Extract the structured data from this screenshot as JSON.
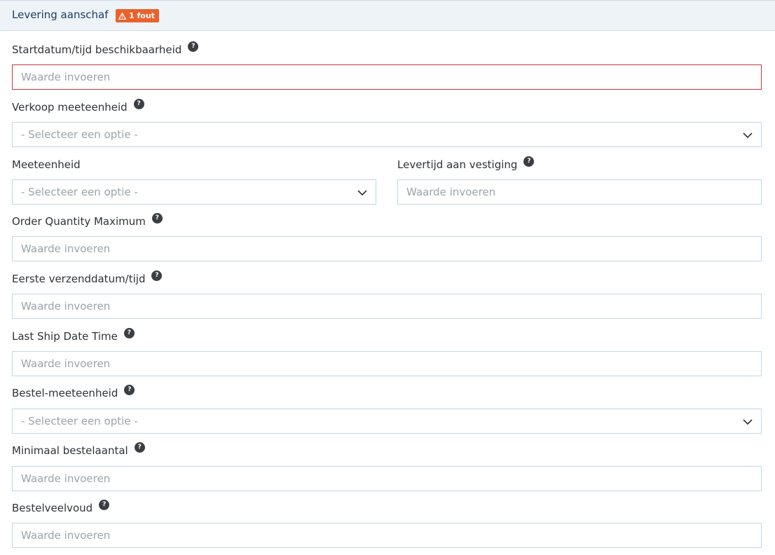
{
  "section": {
    "title": "Levering aanschaf",
    "error_badge": "1 fout"
  },
  "fields": {
    "startdatum": {
      "label": "Startdatum/tijd beschikbaarheid",
      "placeholder": "Waarde invoeren"
    },
    "verkoop_meeteenheid": {
      "label": "Verkoop meeteenheid",
      "placeholder": "- Selecteer een optie -"
    },
    "meeteenheid": {
      "label": "Meeteenheid",
      "placeholder": "- Selecteer een optie -"
    },
    "levertijd": {
      "label": "Levertijd aan vestiging",
      "placeholder": "Waarde invoeren"
    },
    "order_quantity_maximum": {
      "label": "Order Quantity Maximum",
      "placeholder": "Waarde invoeren"
    },
    "eerste_verzenddatum": {
      "label": "Eerste verzenddatum/tijd",
      "placeholder": "Waarde invoeren"
    },
    "last_ship_date_time": {
      "label": "Last Ship Date Time",
      "placeholder": "Waarde invoeren"
    },
    "bestel_meeteenheid": {
      "label": "Bestel-meeteenheid",
      "placeholder": "- Selecteer een optie -"
    },
    "minimaal_bestelaantal": {
      "label": "Minimaal bestelaantal",
      "placeholder": "Waarde invoeren"
    },
    "bestelveelvoud": {
      "label": "Bestelveelvoud",
      "placeholder": "Waarde invoeren"
    }
  },
  "help_icon_glyph": "?",
  "colors": {
    "header_bg": "#eef3f8",
    "header_title": "#1c3c64",
    "badge": "#e9622c",
    "error_border": "#c9353e",
    "field_border": "#c5d6e2",
    "placeholder": "#9aa3ab"
  }
}
